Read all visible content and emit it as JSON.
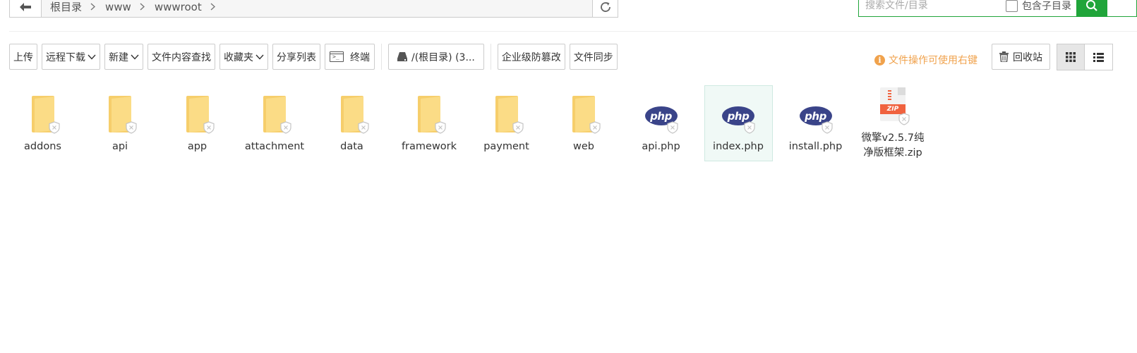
{
  "breadcrumb": [
    "根目录",
    "www",
    "wwwroot"
  ],
  "search": {
    "placeholder": "搜索文件/目录",
    "include_subdir_label": "包含子目录"
  },
  "toolbar": {
    "upload": "上传",
    "remote_download": "远程下载",
    "new": "新建",
    "content_search": "文件内容查找",
    "favorites": "收藏夹",
    "share_list": "分享列表",
    "terminal": "终端",
    "disk": "/(根目录) (3...",
    "tamper_proof": "企业级防篡改",
    "file_sync": "文件同步"
  },
  "tip": "文件操作可使用右键",
  "recycle_bin": "回收站",
  "view_mode": "grid",
  "colors": {
    "accent": "#20a53a",
    "tip": "#f0a24c",
    "folder": "#f6ce6b",
    "php": "#3a4489",
    "zip": "#f0623f"
  },
  "files": [
    {
      "name": "addons",
      "type": "folder",
      "icon": "folder-icon"
    },
    {
      "name": "api",
      "type": "folder",
      "icon": "folder-icon"
    },
    {
      "name": "app",
      "type": "folder",
      "icon": "folder-icon"
    },
    {
      "name": "attachment",
      "type": "folder",
      "icon": "folder-icon"
    },
    {
      "name": "data",
      "type": "folder",
      "icon": "folder-icon"
    },
    {
      "name": "framework",
      "type": "folder",
      "icon": "folder-icon"
    },
    {
      "name": "payment",
      "type": "folder",
      "icon": "folder-icon"
    },
    {
      "name": "web",
      "type": "folder",
      "icon": "folder-icon"
    },
    {
      "name": "api.php",
      "type": "php",
      "icon": "php-file-icon"
    },
    {
      "name": "index.php",
      "type": "php",
      "icon": "php-file-icon",
      "selected": true
    },
    {
      "name": "install.php",
      "type": "php",
      "icon": "php-file-icon"
    },
    {
      "name": "微擎v2.5.7纯净版框架.zip",
      "type": "zip",
      "icon": "zip-file-icon"
    }
  ]
}
